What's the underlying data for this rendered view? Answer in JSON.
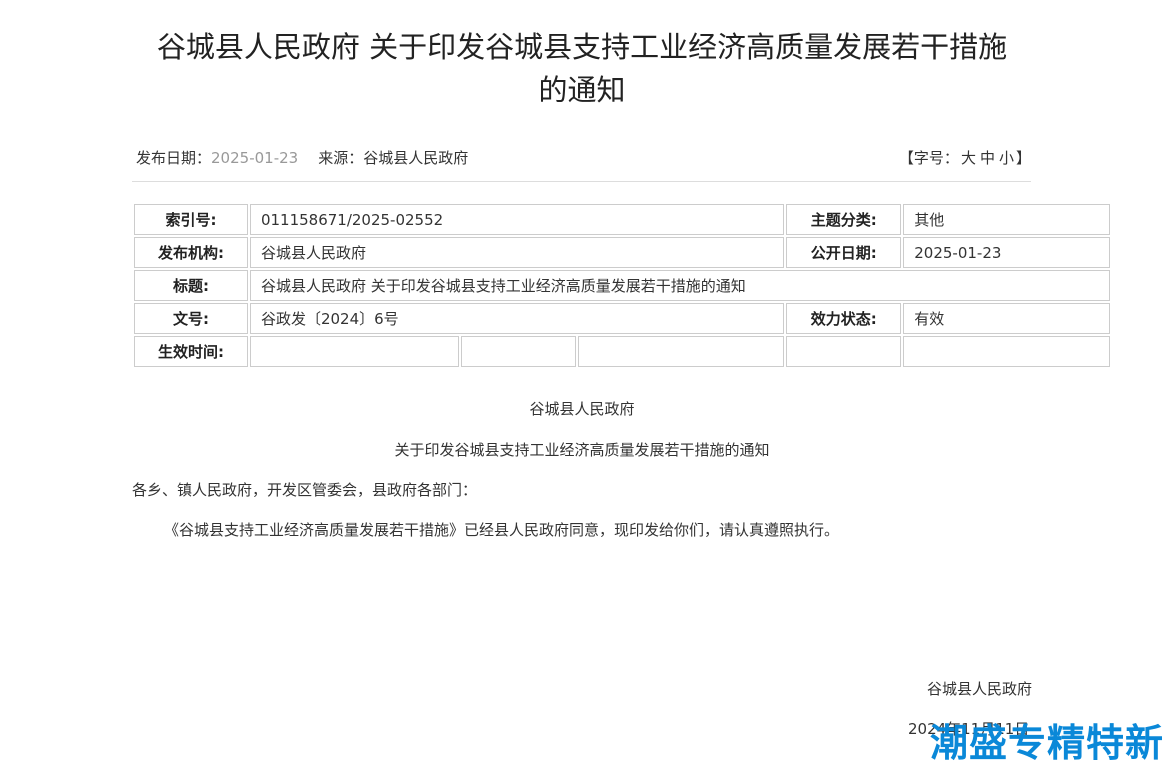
{
  "document": {
    "title_line1": "谷城县人民政府 关于印发谷城县支持工业经济高质量发展若干措施",
    "title_line2": "的通知"
  },
  "meta": {
    "date_label": "发布日期：",
    "date_value": "2025-01-23",
    "source_label": "来源：",
    "source_value": "谷城县人民政府",
    "font_size_prefix": "【字号：",
    "font_large": "大",
    "font_medium": "中",
    "font_small": "小",
    "font_size_suffix": "】"
  },
  "info_table": {
    "index_label": "索引号:",
    "index_value": "011158671/2025-02552",
    "topic_label": "主题分类:",
    "topic_value": "其他",
    "org_label": "发布机构:",
    "org_value": "谷城县人民政府",
    "public_date_label": "公开日期:",
    "public_date_value": "2025-01-23",
    "title_label": "标题:",
    "title_value": "谷城县人民政府 关于印发谷城县支持工业经济高质量发展若干措施的通知",
    "doc_no_label": "文号:",
    "doc_no_value": "谷政发〔2024〕6号",
    "validity_label": "效力状态:",
    "validity_value": "有效",
    "effective_label": "生效时间:"
  },
  "body": {
    "issuer": "谷城县人民政府",
    "subtitle": "关于印发谷城县支持工业经济高质量发展若干措施的通知",
    "recipients": "各乡、镇人民政府，开发区管委会，县政府各部门：",
    "paragraph": "《谷城县支持工业经济高质量发展若干措施》已经县人民政府同意，现印发给你们，请认真遵照执行。",
    "signature": "谷城县人民政府",
    "sign_date": "2024年11月11日"
  },
  "watermark": {
    "text": "潮盛专精特新",
    "color": "#0a88d8"
  }
}
